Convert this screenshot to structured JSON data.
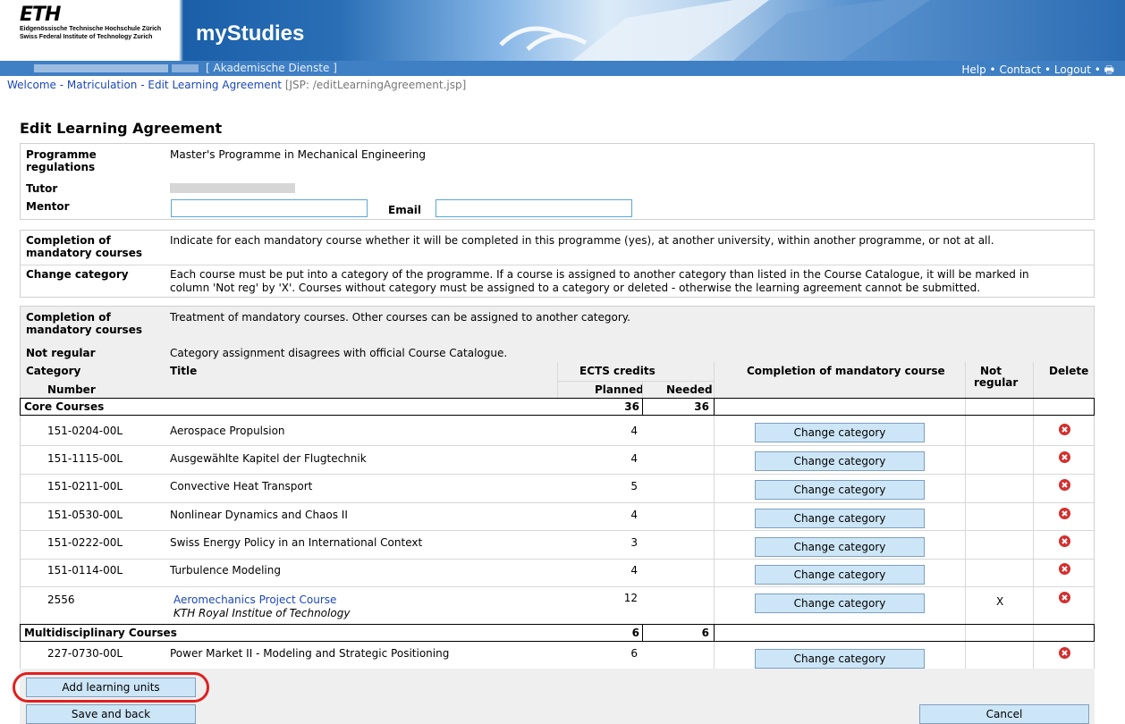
{
  "header": {
    "logo_mark": "ETH",
    "logo_line1": "Eidgenössische Technische Hochschule Zürich",
    "logo_line2": "Swiss Federal Institute of Technology Zurich",
    "app_title": "myStudies",
    "nav_center": "[ Akademische Dienste ]",
    "nav_help": "Help",
    "nav_contact": "Contact",
    "nav_logout": "Logout",
    "nav_sep": " • "
  },
  "breadcrumb": {
    "welcome": "Welcome",
    "matriculation": "Matriculation",
    "edit": "Edit Learning Agreement",
    "sep": " - ",
    "jsp": "[JSP: /editLearningAgreement.jsp]"
  },
  "page_title": "Edit Learning Agreement",
  "info": {
    "programme_label": "Programme regulations",
    "programme_value": "Master's Programme in Mechanical Engineering",
    "tutor_label": "Tutor",
    "mentor_label": "Mentor",
    "mentor_value": "",
    "email_label": "Email",
    "email_value": ""
  },
  "help": {
    "completion_label": "Completion of mandatory courses",
    "completion_text": "Indicate for each mandatory course whether it will be completed in this programme (yes), at another university, within another programme, or not at all.",
    "change_label": "Change category",
    "change_text_1": "Each course must be put into a category of the programme. If a course is assigned to another category than listed in the Course Catalogue, it will be marked in",
    "change_text_2": "column 'Not reg' by 'X'. Courses without category must be assigned to a category or deleted - otherwise the learning agreement cannot be submitted."
  },
  "legend": {
    "completion_label": "Completion of mandatory courses",
    "completion_text": "Treatment of mandatory courses. Other courses can be assigned to another category.",
    "notreg_label": "Not regular",
    "notreg_text": "Category assignment disagrees with official Course Catalogue."
  },
  "table": {
    "col_category": "Category",
    "col_number": "Number",
    "col_title": "Title",
    "col_ects": "ECTS credits",
    "col_planned": "Planned",
    "col_needed": "Needed",
    "col_completion": "Completion of mandatory course",
    "col_notreg_1": "Not",
    "col_notreg_2": "regular",
    "col_delete": "Delete",
    "change_button": "Change category",
    "groups": [
      {
        "name": "Core Courses",
        "planned": "36",
        "needed": "36",
        "rows": [
          {
            "number": "151-0204-00L",
            "title": "Aerospace Propulsion",
            "credits": "4",
            "notreg": ""
          },
          {
            "number": "151-1115-00L",
            "title": "Ausgewählte Kapitel der Flugtechnik",
            "credits": "4",
            "notreg": ""
          },
          {
            "number": "151-0211-00L",
            "title": "Convective Heat Transport",
            "credits": "5",
            "notreg": ""
          },
          {
            "number": "151-0530-00L",
            "title": "Nonlinear Dynamics and Chaos II",
            "credits": "4",
            "notreg": ""
          },
          {
            "number": "151-0222-00L",
            "title": "Swiss Energy Policy in an International Context",
            "credits": "3",
            "notreg": ""
          },
          {
            "number": "151-0114-00L",
            "title": "Turbulence Modeling",
            "credits": "4",
            "notreg": ""
          },
          {
            "number": "2556",
            "title": "Aeromechanics Project Course",
            "subtitle": "KTH Royal Institue of Technology",
            "credits": "12",
            "notreg": "X"
          }
        ]
      },
      {
        "name": "Multidisciplinary Courses",
        "planned": "6",
        "needed": "6",
        "rows": [
          {
            "number": "227-0730-00L",
            "title": "Power Market II - Modeling and Strategic Positioning",
            "credits": "6",
            "notreg": ""
          }
        ]
      }
    ]
  },
  "buttons": {
    "add_units": "Add learning units",
    "save_back": "Save and back",
    "cancel": "Cancel"
  },
  "colors": {
    "accent": "#1b47b8",
    "button_bg": "#cde6f7",
    "highlight_ring": "#e02020",
    "delete_icon": "#d32f2f"
  }
}
